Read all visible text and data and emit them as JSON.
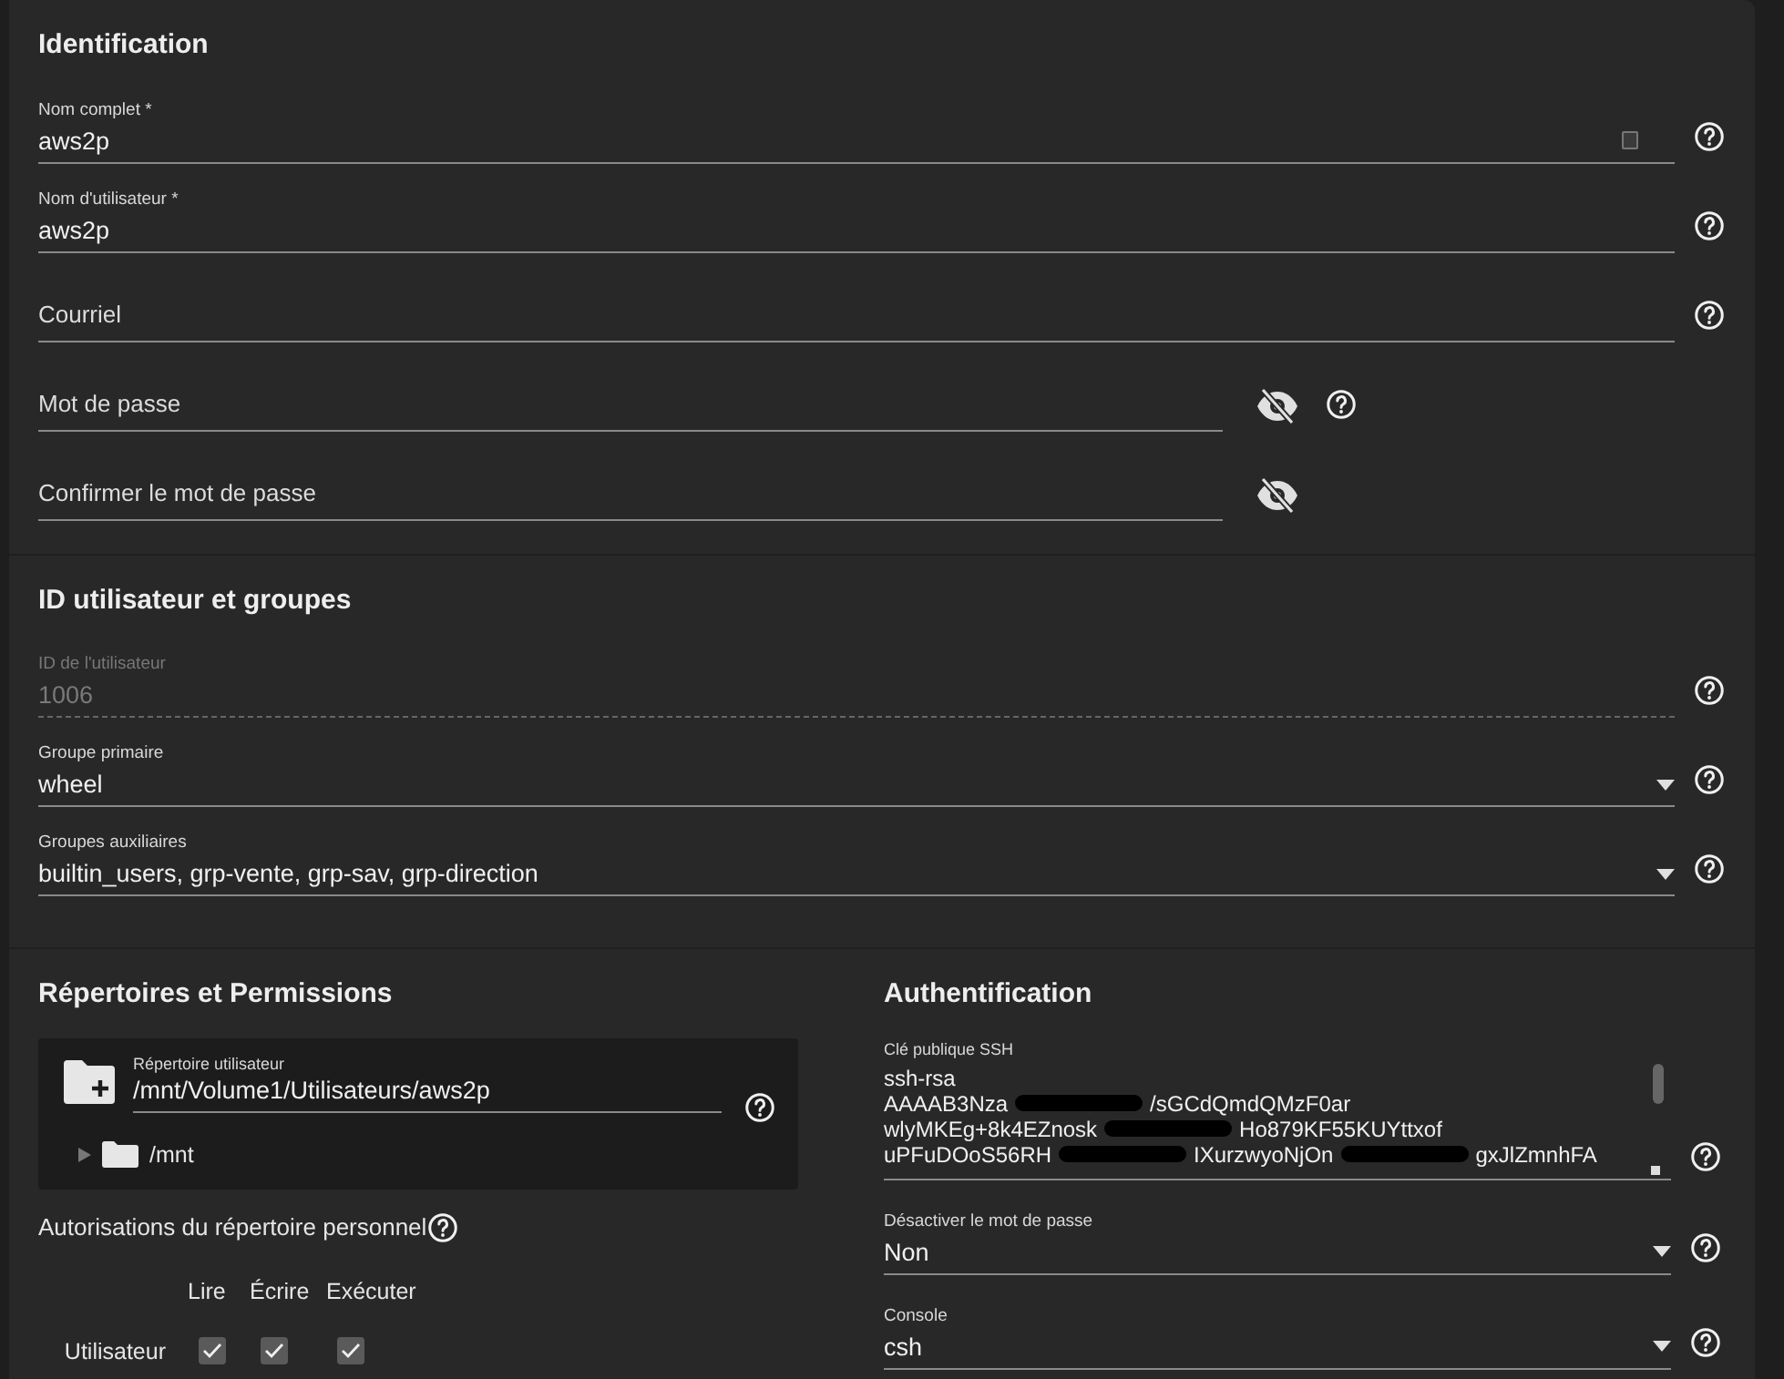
{
  "identification": {
    "title": "Identification",
    "fields": [
      {
        "kind": "text",
        "label": "Nom complet *",
        "value": "aws2p",
        "help": true,
        "autofill_icon": true
      },
      {
        "kind": "text",
        "label": "Nom d'utilisateur *",
        "value": "aws2p",
        "help": true
      },
      {
        "kind": "text",
        "label": "Courriel",
        "help": true
      },
      {
        "kind": "password",
        "label": "Mot de passe",
        "help": true
      },
      {
        "kind": "password",
        "label": "Confirmer le mot de passe",
        "help": false
      }
    ]
  },
  "ids_groups": {
    "title": "ID utilisateur et groupes",
    "fields": [
      {
        "kind": "text",
        "label": "ID de l'utilisateur",
        "value": "1006",
        "help": true,
        "disabled": true
      },
      {
        "kind": "select",
        "label": "Groupe primaire",
        "value": "wheel",
        "help": true,
        "disabled": false
      },
      {
        "kind": "select",
        "label": "Groupes auxiliaires",
        "value": "builtin_users, grp-vente, grp-sav, grp-direction",
        "help": true,
        "disabled": false
      }
    ]
  },
  "directories": {
    "title": "Répertoires et Permissions",
    "home_directory": {
      "label": "Répertoire utilisateur",
      "value": "/mnt/Volume1/Utilisateurs/aws2p",
      "tree": [
        {
          "label": "/mnt",
          "expanded": false
        }
      ]
    },
    "permissions": {
      "label": "Autorisations du répertoire personnel",
      "columns": [
        "Lire",
        "Écrire",
        "Exécuter"
      ],
      "rows": [
        {
          "label": "Utilisateur",
          "checks": [
            true,
            true,
            true
          ]
        }
      ]
    }
  },
  "authentication": {
    "title": "Authentification",
    "ssh_key": {
      "label": "Clé publique SSH",
      "lines": [
        [
          "ssh-rsa"
        ],
        [
          "AAAAB3Nza",
          "/sGCdQmdQMzF0ar"
        ],
        [
          "wlyMKEg+8k4EZnosk",
          "Ho879KF55KUYttxof"
        ],
        [
          "uPFuDOoS56RH",
          "IXurzwyoNjOn",
          "gxJlZmnhFA"
        ]
      ]
    },
    "fields": [
      {
        "kind": "select",
        "label": "Désactiver le mot de passe",
        "value": "Non",
        "help": true
      },
      {
        "kind": "select",
        "label": "Console",
        "value": "csh",
        "help": true
      }
    ]
  }
}
